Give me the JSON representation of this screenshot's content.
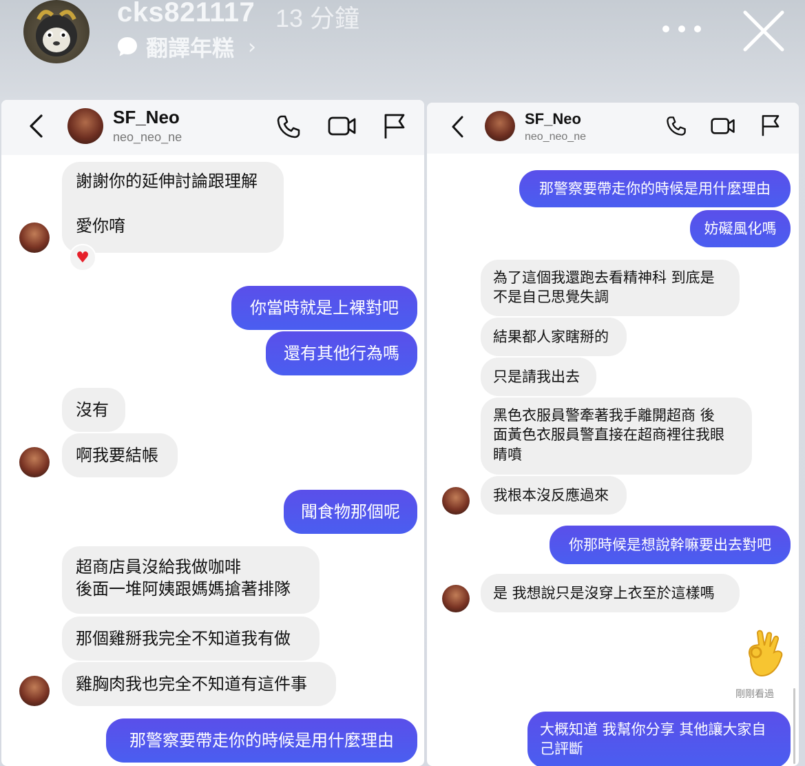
{
  "story": {
    "username": "cks821117",
    "time": "13 分鐘",
    "caption": "翻譯年糕",
    "colors": {
      "header_text": "#f4f6f8"
    },
    "icons": [
      "avatar",
      "speech-bubble-icon",
      "chevron-right-icon",
      "more-icon",
      "close-icon"
    ]
  },
  "left": {
    "header": {
      "name": "SF_Neo",
      "handle": "neo_neo_ne"
    },
    "messages": [
      {
        "side": "in",
        "text": "謝謝你的延伸討論跟理解\n\n愛你唷",
        "reaction": "♥"
      },
      {
        "side": "out",
        "text": "你當時就是上裸對吧"
      },
      {
        "side": "out",
        "text": "還有其他行為嗎"
      },
      {
        "side": "in",
        "text": "沒有"
      },
      {
        "side": "in",
        "text": "啊我要結帳"
      },
      {
        "side": "out",
        "text": "聞食物那個呢"
      },
      {
        "side": "in",
        "text": "超商店員沒給我做咖啡\n後面一堆阿姨跟媽媽搶著排隊"
      },
      {
        "side": "in",
        "text": "那個雞掰我完全不知道我有做"
      },
      {
        "side": "in",
        "text": "雞胸肉我也完全不知道有這件事"
      },
      {
        "side": "out",
        "text": "那警察要帶走你的時候是用什麼理由"
      }
    ]
  },
  "right": {
    "header": {
      "name": "SF_Neo",
      "handle": "neo_neo_ne"
    },
    "messages": [
      {
        "side": "out",
        "text": "那警察要帶走你的時候是用什麼理由"
      },
      {
        "side": "out",
        "text": "妨礙風化嗎"
      },
      {
        "side": "in",
        "text": "為了這個我還跑去看精神科 到底是\n不是自己思覺失調"
      },
      {
        "side": "in",
        "text": "結果都人家瞎掰的"
      },
      {
        "side": "in",
        "text": "只是請我出去"
      },
      {
        "side": "in",
        "text": "黑色衣服員警牽著我手離開超商 後\n面黃色衣服員警直接在超商裡往我眼\n睛噴"
      },
      {
        "side": "in",
        "text": "我根本沒反應過來"
      },
      {
        "side": "out",
        "text": "你那時候是想說幹嘛要出去對吧"
      },
      {
        "side": "in",
        "text": "是 我想說只是沒穿上衣至於這樣嗎"
      },
      {
        "side": "out",
        "text": "大概知道 我幫你分享 其他讓大家自\n己評斷"
      }
    ],
    "seen_label": "剛剛看過",
    "sticker": "ok-hand-emoji"
  },
  "colors": {
    "outgoing_bubble": "#5a4fea",
    "incoming_bubble": "#efefef",
    "background": "#d6dae2"
  }
}
